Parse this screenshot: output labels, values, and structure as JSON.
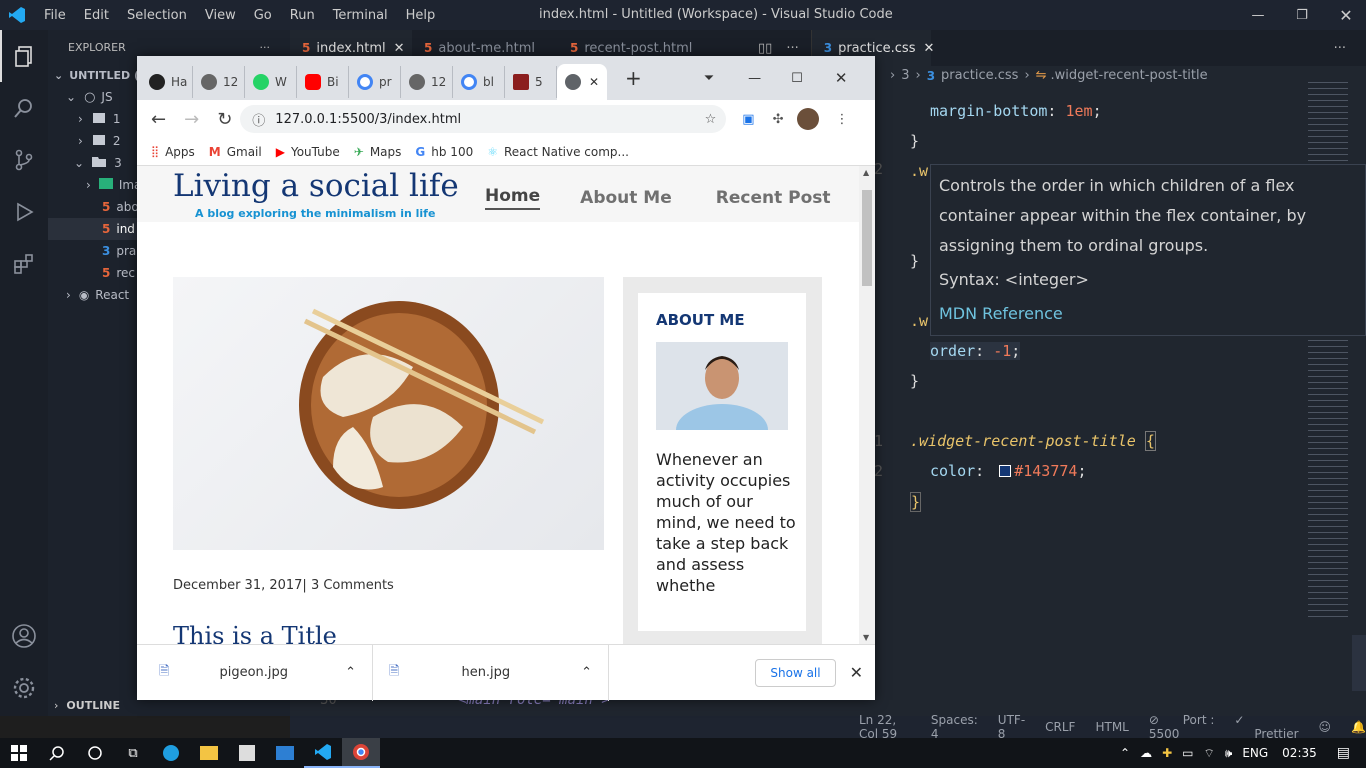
{
  "vscode": {
    "window_title": "index.html - Untitled (Workspace) - Visual Studio Code",
    "menu": [
      "File",
      "Edit",
      "Selection",
      "View",
      "Go",
      "Run",
      "Terminal",
      "Help"
    ],
    "explorer_title": "EXPLORER",
    "workspace_label": "UNTITLED (W",
    "tree": [
      {
        "label": "JS",
        "indent": 0,
        "kind": "folder-open"
      },
      {
        "label": "1",
        "indent": 1,
        "kind": "folder"
      },
      {
        "label": "2",
        "indent": 1,
        "kind": "folder"
      },
      {
        "label": "3",
        "indent": 1,
        "kind": "folder-open"
      },
      {
        "label": "Ima",
        "indent": 2,
        "kind": "images"
      },
      {
        "label": "abo",
        "indent": 2,
        "kind": "html"
      },
      {
        "label": "ind",
        "indent": 2,
        "kind": "html"
      },
      {
        "label": "pra",
        "indent": 2,
        "kind": "css"
      },
      {
        "label": "rec",
        "indent": 2,
        "kind": "html"
      },
      {
        "label": "React",
        "indent": 0,
        "kind": "react"
      }
    ],
    "outline_label": "OUTLINE",
    "left_tabs": [
      "index.html",
      "about-me.html",
      "recent-post.html"
    ],
    "right_tab": "practice.css",
    "breadcrumb": {
      "folder": "3",
      "file": "practice.css",
      "symbol": ".widget-recent-post-title"
    },
    "code": {
      "line1_prop": "margin-bottom",
      "line1_val": "1em",
      "close1": "}",
      "sel1": ".w",
      "close2": "}",
      "sel2": ".w",
      "line_order_prop": "order",
      "line_order_val": "-1",
      "close3": "}",
      "selector": ".widget-recent-post-title",
      "brace_open": "{",
      "color_prop": "color",
      "color_val": "#143774",
      "close4": "}"
    },
    "line_numbers": [
      "2",
      "1",
      "2"
    ],
    "bottom_code": "<main role=\"main\">",
    "bottom_line": "30",
    "hover": {
      "description": "Controls the order in which children of a flex container appear within the flex container, by assigning them to ordinal groups.",
      "syntax": "Syntax: <integer>",
      "link": "MDN Reference"
    },
    "status": [
      "Ln 22, Col 59",
      "Spaces: 4",
      "UTF-8",
      "CRLF",
      "HTML",
      "Port : 5500",
      "Prettier"
    ]
  },
  "chrome": {
    "tabs": [
      "Ha",
      "12",
      "W",
      "Bi",
      "pr",
      "12",
      "bl",
      "5"
    ],
    "url": "127.0.0.1:5500/3/index.html",
    "bookmarks": [
      "Apps",
      "Gmail",
      "YouTube",
      "Maps",
      "hb 100",
      "React Native comp..."
    ],
    "downloads": [
      "pigeon.jpg",
      "hen.jpg"
    ],
    "show_all": "Show all"
  },
  "site": {
    "title": "Living a social life",
    "tagline": "A blog exploring the minimalism in life",
    "nav": [
      "Home",
      "About Me",
      "Recent Post"
    ],
    "meta": "December 31, 2017| 3 Comments",
    "post_title": "This is a Title",
    "about_heading": "ABOUT ME",
    "about_text": "Whenever an activity occupies much of our mind, we need to take a step back and assess whethe"
  },
  "taskbar": {
    "lang": "ENG",
    "time": "02:35"
  },
  "colors": {
    "accent": "#143774",
    "tagline": "#1792d2",
    "css_selector": "#e9c46a"
  }
}
